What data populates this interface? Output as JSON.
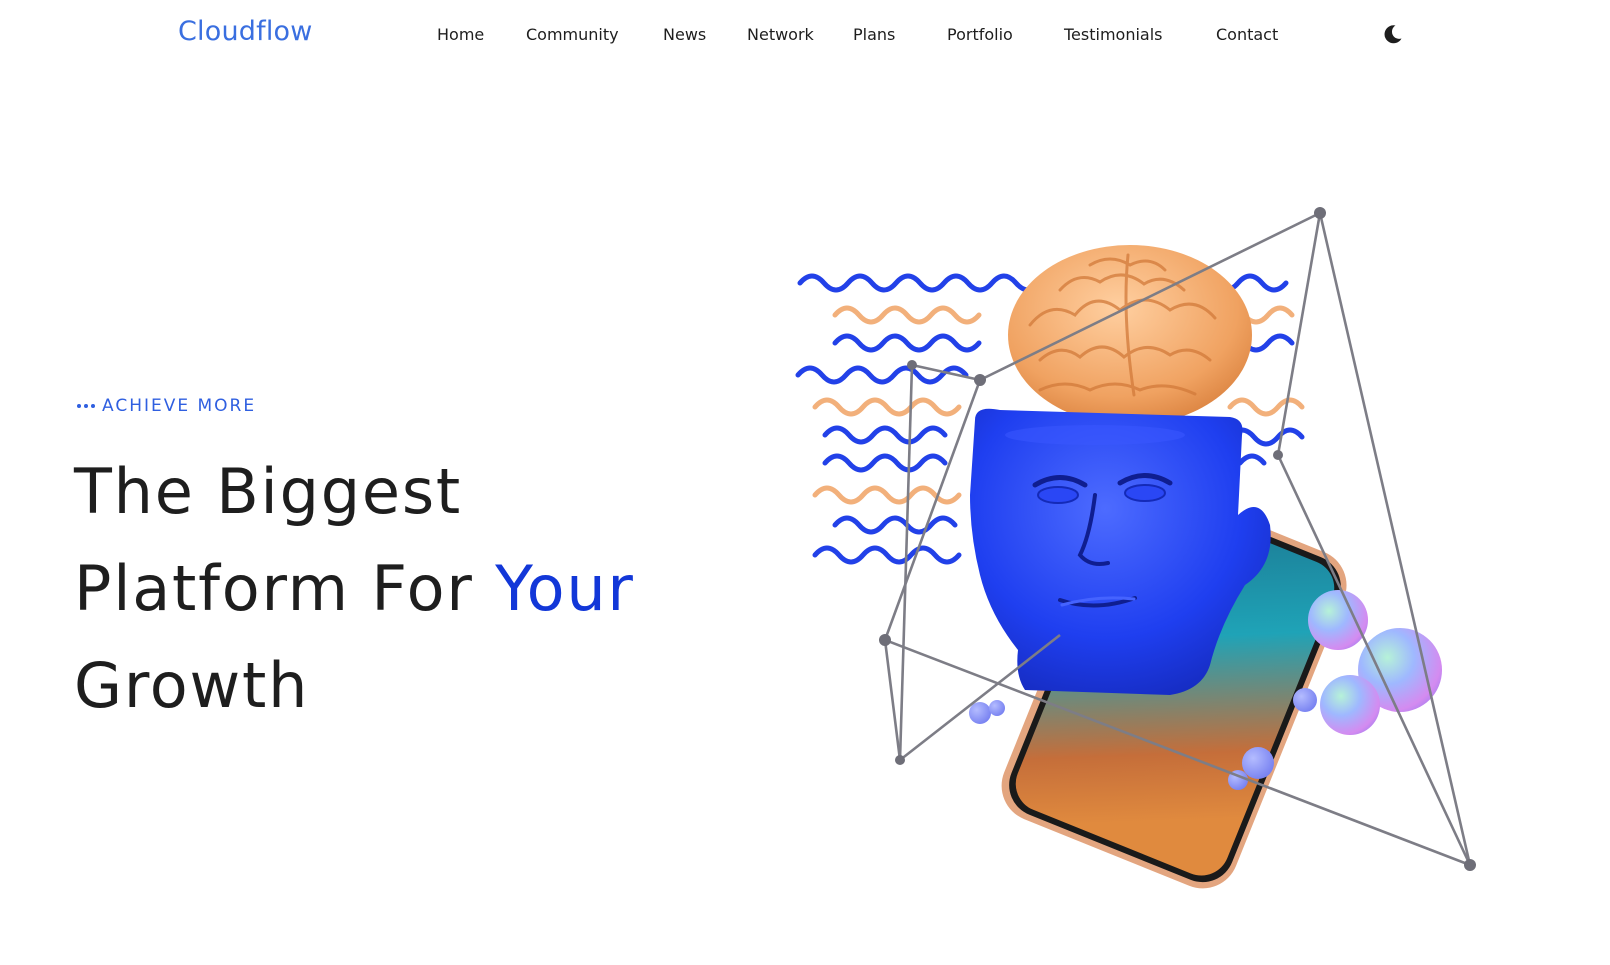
{
  "navbar": {
    "brand": "Cloudflow",
    "links": [
      "Home",
      "Community",
      "News",
      "Network",
      "Plans",
      "Portfolio",
      "Testimonials",
      "Contact"
    ],
    "theme_toggle_icon": "moon-icon"
  },
  "hero": {
    "eyebrow": "ACHIEVE MORE",
    "headline": {
      "line1": "The Biggest",
      "line2_prefix": "Platform For ",
      "line2_accent": "Your",
      "line3": "Growth"
    },
    "illustration": "3d-head-brain-phone-illustration"
  },
  "colors": {
    "brand": "#3a6fe0",
    "accent": "#1237d8",
    "eyebrow": "#2f5fe0",
    "text": "#1e1e1e"
  }
}
